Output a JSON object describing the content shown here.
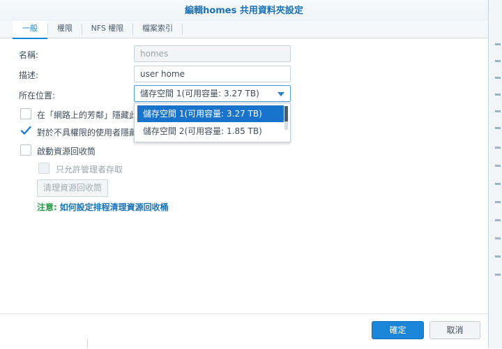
{
  "window": {
    "title": "編輯homes 共用資料夾設定"
  },
  "tabs": [
    {
      "label": "一般",
      "active": true
    },
    {
      "label": "權限",
      "active": false
    },
    {
      "label": "NFS 權限",
      "active": false
    },
    {
      "label": "檔案索引",
      "active": false
    }
  ],
  "form": {
    "name_label": "名稱:",
    "name_value": "homes",
    "desc_label": "描述:",
    "desc_value": "user home",
    "location_label": "所在位置:",
    "location_value": "儲存空間 1(可用容量: 3.27 TB)"
  },
  "dropdown": {
    "options": [
      {
        "label": "儲存空間 1(可用容量: 3.27 TB)",
        "selected": true
      },
      {
        "label": "儲存空間 2(可用容量: 1.85 TB)",
        "selected": false
      }
    ]
  },
  "options": {
    "hide_network": {
      "label": "在「網路上的芳鄰」隱藏此共",
      "checked": false
    },
    "hide_subfolders": {
      "label": "對於不具權限的使用者隱藏子",
      "checked": true
    },
    "recycle_bin": {
      "label": "啟動資源回收筒",
      "checked": false
    },
    "admin_only": {
      "label": "只允許管理者存取",
      "checked": false,
      "disabled": true
    }
  },
  "buttons": {
    "empty_recycle": "清理資源回收筒",
    "ok": "確定",
    "cancel": "取消"
  },
  "note": {
    "prefix": "注意:",
    "link": "如何設定排程清理資源回收桶"
  },
  "colors": {
    "accent": "#1b85d8",
    "link": "#1a72b8",
    "note_green": "#2b9b4d"
  }
}
